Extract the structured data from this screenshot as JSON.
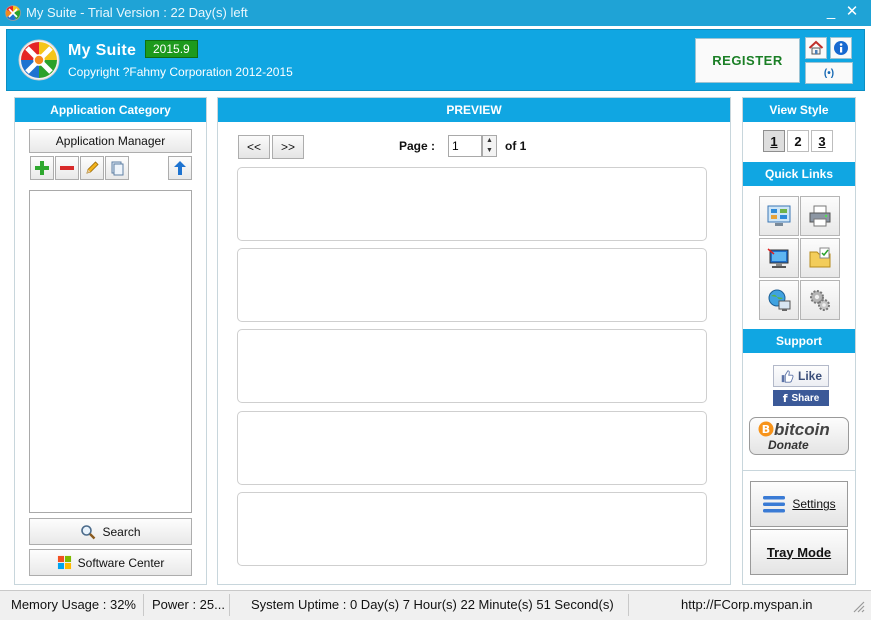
{
  "window": {
    "title": "My Suite - Trial Version : 22 Day(s) left",
    "minimize_label": "_",
    "close_label": "✕"
  },
  "header": {
    "app_name": "My Suite",
    "version": "2015.9",
    "copyright": "Copyright ?Fahmy Corporation 2012-2015",
    "register_label": "REGISTER",
    "home_icon": "home-icon",
    "info_icon": "info-icon",
    "broadcast_label": "(•)"
  },
  "left_panel": {
    "title": "Application Category",
    "manager_label": "Application Manager",
    "tools": [
      "add-icon",
      "remove-icon",
      "edit-icon",
      "copy-icon",
      "move-up-icon"
    ],
    "search_label": "Search",
    "software_center_label": "Software Center"
  },
  "preview": {
    "title": "PREVIEW",
    "prev_label": "<<",
    "next_label": ">>",
    "page_label": "Page :",
    "page_value": "1",
    "of_label": "of 1",
    "card_count": 5
  },
  "right_panel": {
    "view_style_title": "View Style",
    "view_styles": [
      "1",
      "2",
      "3"
    ],
    "active_view": "1",
    "quick_links_title": "Quick Links",
    "quick_links": [
      "control-panel-icon",
      "printer-icon",
      "computer-icon",
      "folder-icon",
      "network-icon",
      "settings-gears-icon"
    ],
    "support_title": "Support",
    "like_label": "Like",
    "share_label": "Share",
    "bitcoin_label": "bitcoin",
    "donate_label": "Donate",
    "settings_label": "Settings",
    "tray_mode_label": "Tray Mode"
  },
  "status": {
    "memory": "Memory Usage : 32%",
    "power": "Power : 25...",
    "uptime": "System Uptime : 0 Day(s) 7 Hour(s) 22 Minute(s) 51 Second(s)",
    "url": "http://FCorp.myspan.in"
  },
  "colors": {
    "accent": "#10a6e2",
    "title_bar": "#1fa3d6",
    "version_badge": "#1d9a1d",
    "register_text": "#1b7f26"
  }
}
